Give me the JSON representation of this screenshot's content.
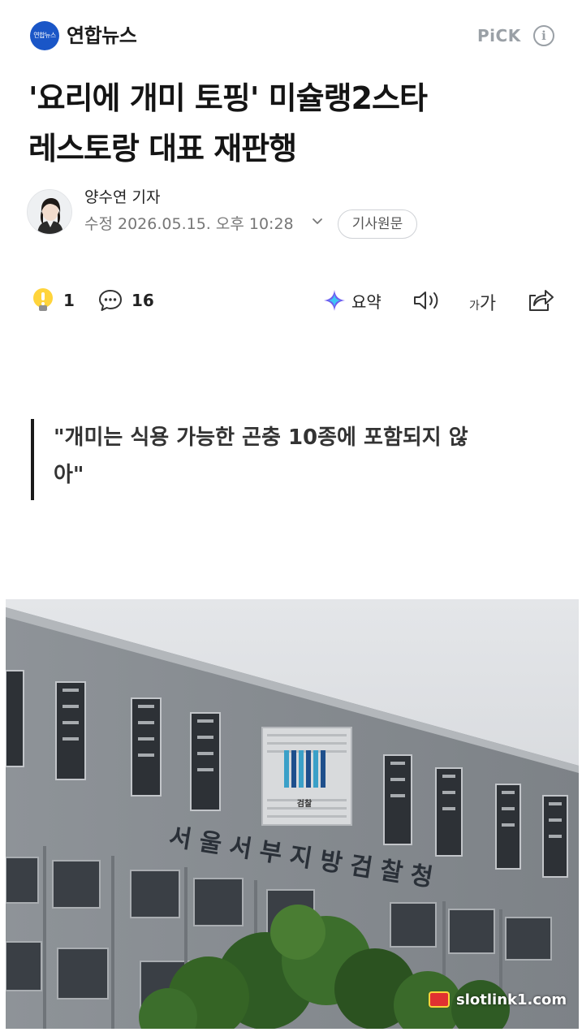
{
  "header": {
    "press_logo_text": "연합뉴스",
    "press_name": "연합뉴스",
    "pick_label": "PiCK",
    "info_icon": "info-icon"
  },
  "article": {
    "title_line1": "'요리에 개미 토핑' 미슐랭2스타",
    "title_line2": "레스토랑 대표 재판행",
    "reporter": "양수연 기자",
    "timestamp": "수정 2026.05.15. 오후 10:28",
    "original_button": "기사원문"
  },
  "actions": {
    "reaction_count": "1",
    "comment_count": "16",
    "summary_label": "요약",
    "font_small": "가",
    "font_big": "가"
  },
  "quote": {
    "line1": "\"개미는 식용 가능한 곤충 10종에 포함되지 않",
    "line2": "아\""
  },
  "photo": {
    "building_sign": "서울서부지방검찰청",
    "emblem_text": "검찰",
    "watermark": "slotlink1.com"
  },
  "colors": {
    "accent": "#1a56c7",
    "pick": "#9aa0a6",
    "quote_bar": "#1a1a1a"
  }
}
